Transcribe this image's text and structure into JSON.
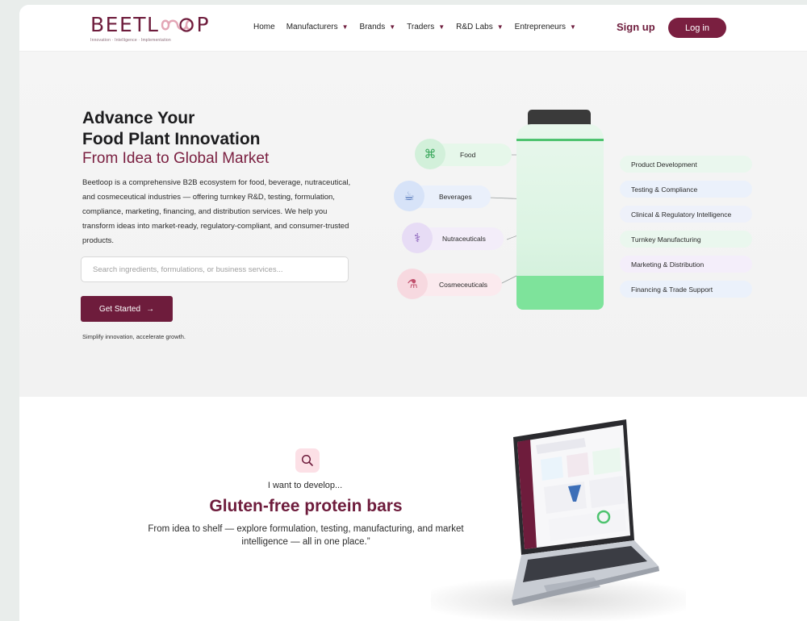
{
  "brand": {
    "name_start": "BEETL",
    "name_end": "P",
    "tagline": "Innovation · Intelligence · Implementation"
  },
  "nav": {
    "items": [
      {
        "label": "Home",
        "dropdown": false
      },
      {
        "label": "Manufacturers",
        "dropdown": true
      },
      {
        "label": "Brands",
        "dropdown": true
      },
      {
        "label": "Traders",
        "dropdown": true
      },
      {
        "label": "R&D Labs",
        "dropdown": true
      },
      {
        "label": "Entrepreneurs",
        "dropdown": true
      }
    ],
    "signup_label": "Sign up",
    "login_label": "Log in"
  },
  "hero": {
    "title_line1": "Advance Your",
    "title_line2": "Food Plant Innovation",
    "subtitle": "From Idea to Global Market",
    "description": "Beetloop is a comprehensive B2B ecosystem for food, beverage, nutraceutical, and cosmeceutical industries — offering turnkey R&D, testing, formulation, compliance, marketing, financing, and distribution services. We help you transform ideas into market-ready, regulatory-compliant, and consumer-trusted products.",
    "search_placeholder": "Search ingredients, formulations, or business services...",
    "cta_label": "Get Started",
    "cta_arrow": "→",
    "tagline": "Simplify innovation, accelerate growth."
  },
  "categories": [
    {
      "label": "Food",
      "icon": "food-icon",
      "color": "#e6f7ea",
      "icon_bg": "#d2f0da"
    },
    {
      "label": "Beverages",
      "icon": "beverage-icon",
      "color": "#eaf0fb",
      "icon_bg": "#d7e3f8"
    },
    {
      "label": "Nutraceuticals",
      "icon": "nutraceutical-icon",
      "color": "#f3edf9",
      "icon_bg": "#e7dcf5"
    },
    {
      "label": "Cosmeceuticals",
      "icon": "cosmeceutical-icon",
      "color": "#fbeaee",
      "icon_bg": "#f7d9e0"
    }
  ],
  "services": [
    {
      "label": "Product Development",
      "color": "#eaf7ee"
    },
    {
      "label": "Testing & Compliance",
      "color": "#ebf1fb"
    },
    {
      "label": "Clinical & Regulatory Intelligence",
      "color": "#eef1fa"
    },
    {
      "label": "Turnkey Manufacturing",
      "color": "#eaf7ee"
    },
    {
      "label": "Marketing & Distribution",
      "color": "#f4eefa"
    },
    {
      "label": "Financing & Trade Support",
      "color": "#ebf1fb"
    }
  ],
  "lower": {
    "intro": "I want to develop...",
    "product": "Gluten-free protein bars",
    "description": "From idea to shelf — explore formulation, testing, manufacturing, and market intelligence — all in one place.”"
  },
  "colors": {
    "brand": "#6e1c3c",
    "accent_green": "#7ee39b"
  }
}
